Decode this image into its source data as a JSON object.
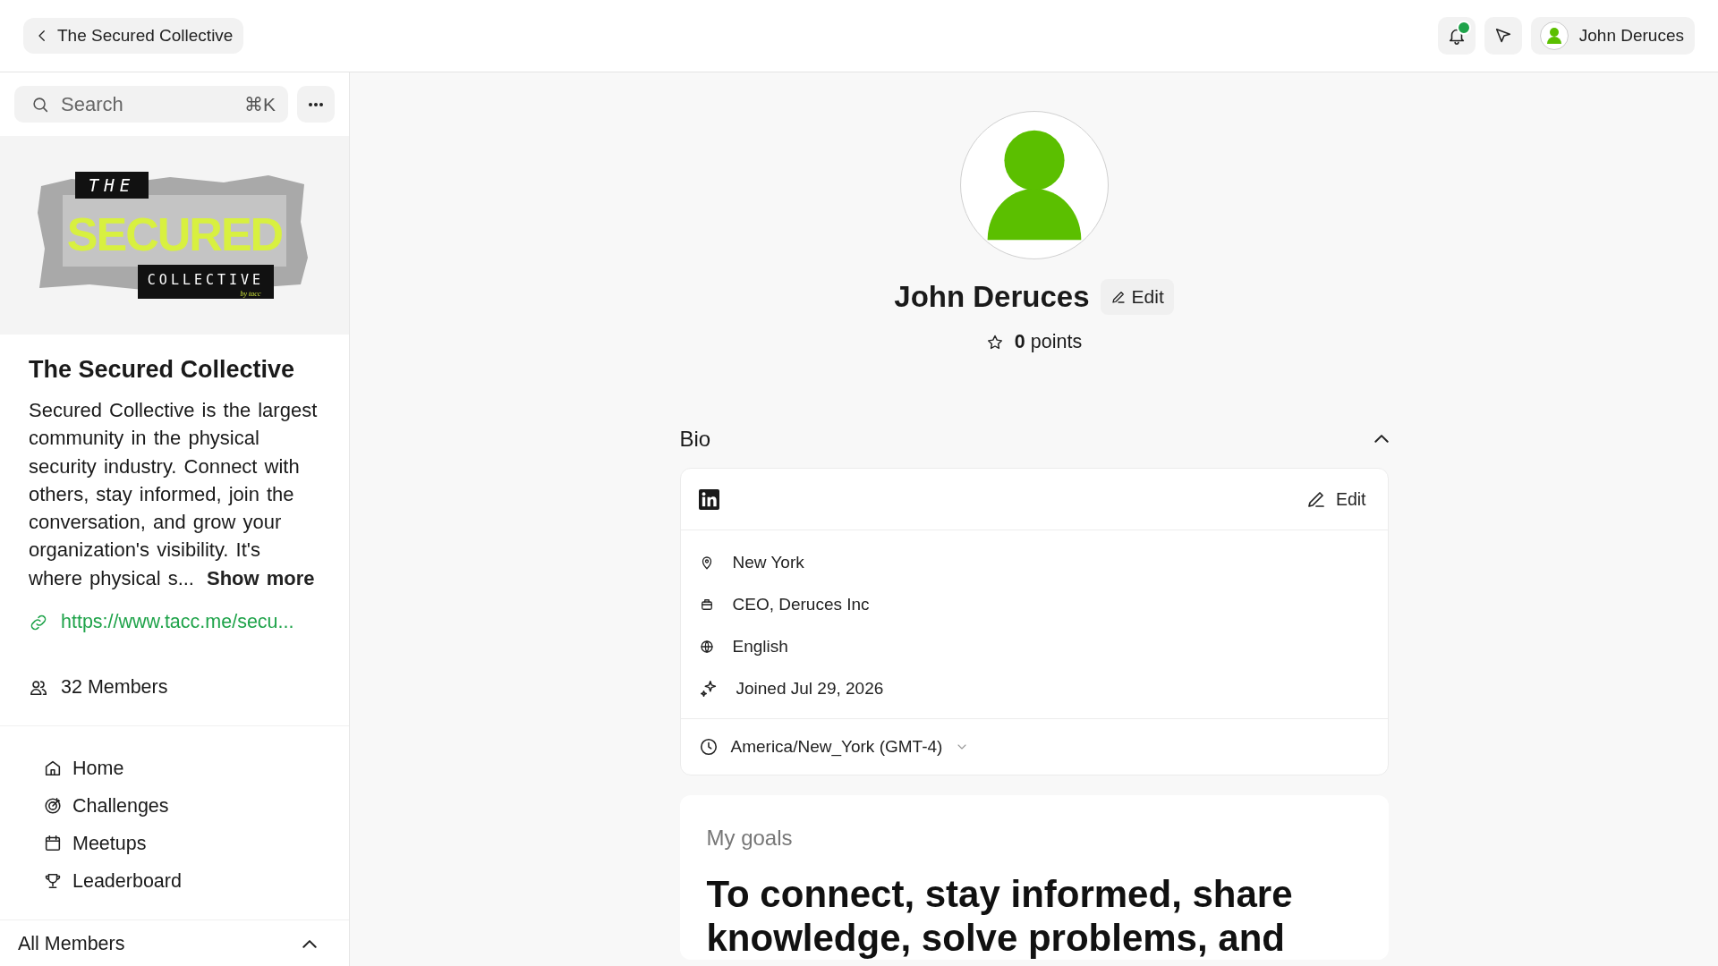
{
  "header": {
    "back_label": "The Secured Collective",
    "has_notification": true,
    "user_name": "John Deruces"
  },
  "sidebar": {
    "search": {
      "placeholder": "Search",
      "shortcut": "⌘K"
    },
    "banner_logo": {
      "top": "THE",
      "main": "SECURED",
      "bottom": "COLLECTIVE",
      "tag": "by tacc"
    },
    "title": "The Secured Collective",
    "description": "Secured Collective is the largest community in the physical security industry. Connect with others, stay informed, join the conversation, and grow your organization's visibility. It's where physical s...",
    "show_more": "Show more",
    "link": "https://www.tacc.me/secu...",
    "members": "32 Members",
    "nav": [
      {
        "kind": "home",
        "label": "Home",
        "selected": false
      },
      {
        "kind": "challenges",
        "label": "Challenges",
        "selected": false
      },
      {
        "kind": "meetups",
        "label": "Meetups",
        "selected": false
      },
      {
        "kind": "leaderboard",
        "label": "Leaderboard",
        "selected": false
      }
    ],
    "section": {
      "label": "All Members",
      "expanded": true
    }
  },
  "profile": {
    "name": "John Deruces",
    "edit": "Edit",
    "points_value": "0",
    "points_label": "points"
  },
  "bio": {
    "title": "Bio",
    "expanded": true,
    "edit": "Edit",
    "details": [
      {
        "kind": "location",
        "text": "New York"
      },
      {
        "kind": "work",
        "text": "CEO, Deruces Inc"
      },
      {
        "kind": "language",
        "text": "English"
      },
      {
        "kind": "joined",
        "text": "Joined Jul 29, 2026"
      }
    ],
    "timezone": "America/New_York (GMT-4)"
  },
  "goals": {
    "title": "My goals",
    "text": "To connect, stay informed, share knowledge, solve problems, and"
  }
}
